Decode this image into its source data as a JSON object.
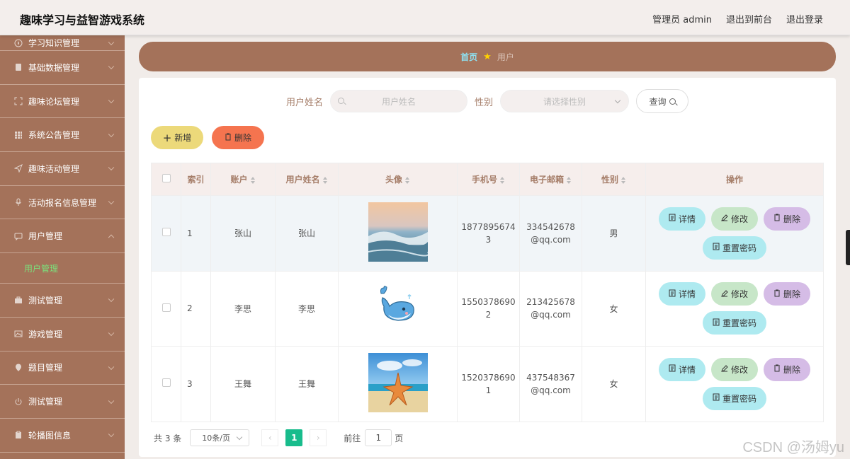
{
  "app": {
    "title": "趣味学习与益智游戏系统"
  },
  "top_links": {
    "admin": "管理员 admin",
    "front": "退出到前台",
    "logout": "退出登录"
  },
  "sidebar": {
    "items": [
      {
        "label": "学习知识管理",
        "icon": "compass-icon"
      },
      {
        "label": "基础数据管理",
        "icon": "database-icon"
      },
      {
        "label": "趣味论坛管理",
        "icon": "fullscreen-icon"
      },
      {
        "label": "系统公告管理",
        "icon": "grid-icon"
      },
      {
        "label": "趣味活动管理",
        "icon": "send-icon"
      },
      {
        "label": "活动报名信息管理",
        "icon": "microphone-icon"
      },
      {
        "label": "用户管理",
        "icon": "chat-icon"
      },
      {
        "label": "测试管理",
        "icon": "suitcase-icon"
      },
      {
        "label": "游戏管理",
        "icon": "picture-icon"
      },
      {
        "label": "题目管理",
        "icon": "location-icon"
      },
      {
        "label": "测试管理",
        "icon": "power-icon"
      },
      {
        "label": "轮播图信息",
        "icon": "clipboard-icon"
      }
    ],
    "submenu": {
      "label": "用户管理"
    }
  },
  "breadcrumb": {
    "home": "首页",
    "current": "用户"
  },
  "search": {
    "name_label": "用户姓名",
    "name_placeholder": "用户姓名",
    "gender_label": "性别",
    "gender_placeholder": "请选择性别",
    "query_label": "查询"
  },
  "actions": {
    "add": "新增",
    "delete": "删除"
  },
  "table": {
    "headers": [
      "索引",
      "账户",
      "用户姓名",
      "头像",
      "手机号",
      "电子邮箱",
      "性别",
      "操作"
    ],
    "rows": [
      {
        "index": "1",
        "account": "张山",
        "name": "张山",
        "avatar": "ocean-wave",
        "phone_1": "1877895674",
        "phone_2": "3",
        "email_1": "334542678",
        "email_2": "@qq.com",
        "gender": "男"
      },
      {
        "index": "2",
        "account": "李思",
        "name": "李思",
        "avatar": "cartoon-whale",
        "phone_1": "1550378690",
        "phone_2": "2",
        "email_1": "213425678",
        "email_2": "@qq.com",
        "gender": "女"
      },
      {
        "index": "3",
        "account": "王舞",
        "name": "王舞",
        "avatar": "starfish-beach",
        "phone_1": "1520378690",
        "phone_2": "1",
        "email_1": "437548367",
        "email_2": "@qq.com",
        "gender": "女"
      }
    ],
    "ops": {
      "detail": "详情",
      "edit": "修改",
      "delete": "删除",
      "reset": "重置密码"
    }
  },
  "pagination": {
    "total": "共 3 条",
    "page_size": "10条/页",
    "current": "1",
    "goto": "前往",
    "goto_value": "1",
    "page_unit": "页"
  },
  "watermark": "CSDN @汤姆yu",
  "colors": {
    "sidebar": "#a4725a",
    "accent_green": "#18bc8c",
    "header_text": "#a57d68"
  }
}
